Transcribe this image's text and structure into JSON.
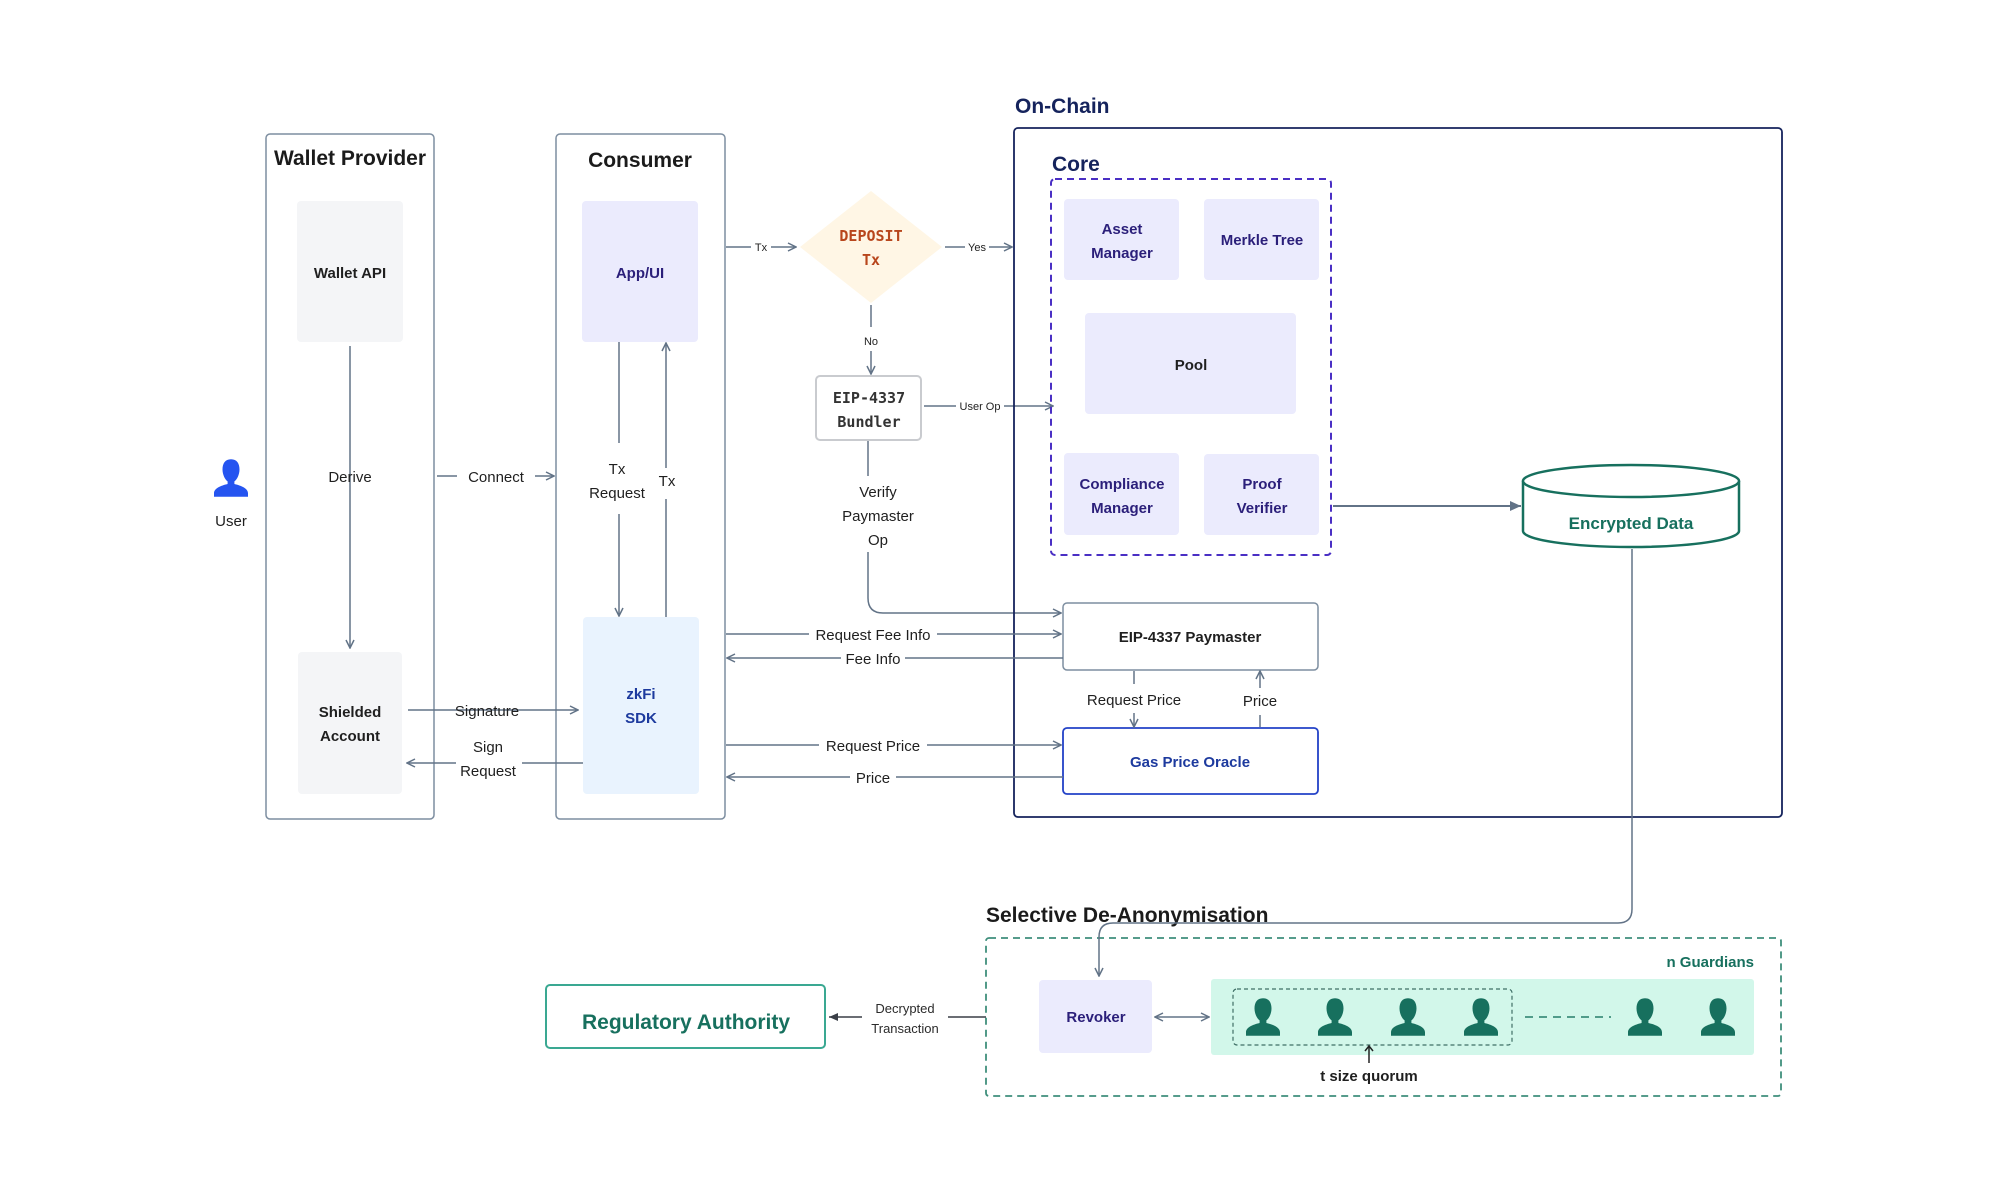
{
  "colors": {
    "edge": "#627387",
    "lane_border": "#7d8ea0",
    "onchain_border": "#15235c",
    "core_dash": "#4a2fc4",
    "core_box_fill": "#ebebfd",
    "neutral_box_fill": "#f4f5f7",
    "sdk_fill": "#e9f3fe",
    "diamond_fill": "#fff6e5",
    "diamond_text": "#b8461c",
    "teal": "#17705e",
    "guardian_panel": "#d2f7ea",
    "user_icon": "#2554f0",
    "oracle_border": "#2342c7"
  },
  "lanes": {
    "wallet_provider": {
      "title": "Wallet Provider",
      "wallet_api": "Wallet API",
      "shielded_account": [
        "Shielded",
        "Account"
      ]
    },
    "consumer": {
      "title": "Consumer",
      "app_ui": "App/UI",
      "sdk": [
        "zkFi",
        "SDK"
      ]
    }
  },
  "user": {
    "label": "User",
    "icon": "user-icon"
  },
  "decision": {
    "lines": [
      "DEPOSIT",
      "Tx"
    ]
  },
  "bundler": {
    "lines": [
      "EIP-4337",
      "Bundler"
    ]
  },
  "onchain": {
    "title": "On-Chain",
    "core": {
      "title": "Core",
      "asset_manager": [
        "Asset",
        "Manager"
      ],
      "merkle_tree": "Merkle Tree",
      "pool": "Pool",
      "compliance_manager": [
        "Compliance",
        "Manager"
      ],
      "proof_verifier": [
        "Proof",
        "Verifier"
      ]
    },
    "paymaster": "EIP-4337 Paymaster",
    "gas_oracle": "Gas Price Oracle",
    "encrypted_data": "Encrypted Data"
  },
  "edges": {
    "derive": "Derive",
    "connect": "Connect",
    "tx_request": [
      "Tx",
      "Request"
    ],
    "tx": "Tx",
    "tx_to_decision": "Tx",
    "yes": "Yes",
    "no": "No",
    "user_op": "User Op",
    "verify_paymaster_op": [
      "Verify",
      "Paymaster",
      "Op"
    ],
    "request_fee_info": "Request Fee Info",
    "fee_info": "Fee Info",
    "request_price_sdk": "Request Price",
    "price_sdk": "Price",
    "request_price_pm": "Request Price",
    "price_pm": "Price",
    "signature": "Signature",
    "sign_request": [
      "Sign",
      "Request"
    ],
    "decrypted_transaction": [
      "Decrypted",
      "Transaction"
    ],
    "t_size_quorum": "t size quorum"
  },
  "deanonymisation": {
    "title": "Selective De-Anonymisation",
    "revoker": "Revoker",
    "guardians_label": "n Guardians",
    "guardian_icon": "guardian-icon",
    "guardian_count_shown": 6,
    "quorum_count_shown": 4
  },
  "regulatory": {
    "label": "Regulatory Authority"
  }
}
